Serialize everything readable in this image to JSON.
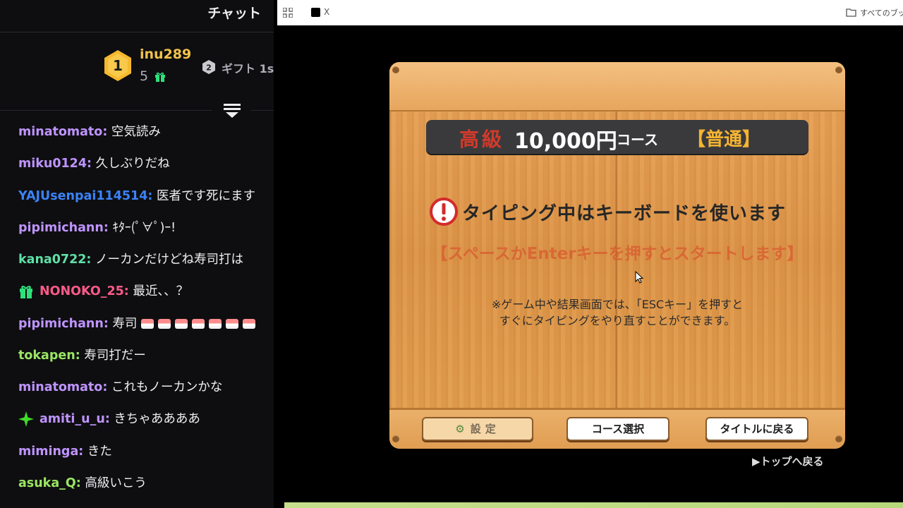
{
  "chat": {
    "title": "チャット",
    "leaderboard": {
      "top_rank": "1",
      "top_user": "inu289",
      "top_count": "5",
      "second_rank": "2",
      "second_text": "ギフト 1s"
    },
    "messages": [
      {
        "user": "minatomato:",
        "text": " 空気読み",
        "color": "#bf94ff"
      },
      {
        "user": "miku0124:",
        "text": " 久しぶりだね",
        "color": "#bf94ff"
      },
      {
        "user": "YAJUsenpai114514:",
        "text": " 医者です死にます",
        "color": "#3b82f6"
      },
      {
        "user": "pipimichann:",
        "text": " ｷﾀｰ(ﾟ∀ﾟ)ｰ!",
        "color": "#bf94ff"
      },
      {
        "user": "kana0722:",
        "text": " ノーカンだけどね寿司打は",
        "color": "#5fe0a8"
      },
      {
        "user": "NONOKO_25:",
        "text": " 最近、、？",
        "color": "#ff5a8a"
      },
      {
        "user": "pipimichann:",
        "text": " 寿司",
        "color": "#bf94ff"
      },
      {
        "user": "tokapen:",
        "text": " 寿司打だー",
        "color": "#9be564"
      },
      {
        "user": "minatomato:",
        "text": " これもノーカンかな",
        "color": "#bf94ff"
      },
      {
        "user": "amiti_u_u:",
        "text": " きちゃああああ",
        "color": "#bf94ff"
      },
      {
        "user": "miminga:",
        "text": " きた",
        "color": "#bf94ff"
      },
      {
        "user": "asuka_Q:",
        "text": " 高級いこう",
        "color": "#9be564"
      }
    ]
  },
  "browser": {
    "tab_label": "X",
    "bookmarks_label": "すべてのブックマ"
  },
  "game": {
    "course_grade": "高級",
    "course_price": "10,000円",
    "course_label": "コース",
    "course_difficulty": "【普通】",
    "keyboard_notice": "タイピング中はキーボードを使います",
    "start_hint": "【スペースかEnterキーを押すとスタートします】",
    "esc_note_line1": "※ゲーム中や結果画面では、「ESCキー」を押すと",
    "esc_note_line2": "すぐにタイピングをやり直すことができます。",
    "settings_label": "設定",
    "course_select_label": "コース選択",
    "back_to_title_label": "タイトルに戻る",
    "top_link_label": "▶トップへ戻る"
  },
  "colors": {
    "chat_bg": "#0e0e10",
    "board_wood": "#e3a050",
    "banner_bg": "#3a3a3c",
    "grade_red": "#d23a2a",
    "difficulty_yellow": "#f5b431"
  }
}
